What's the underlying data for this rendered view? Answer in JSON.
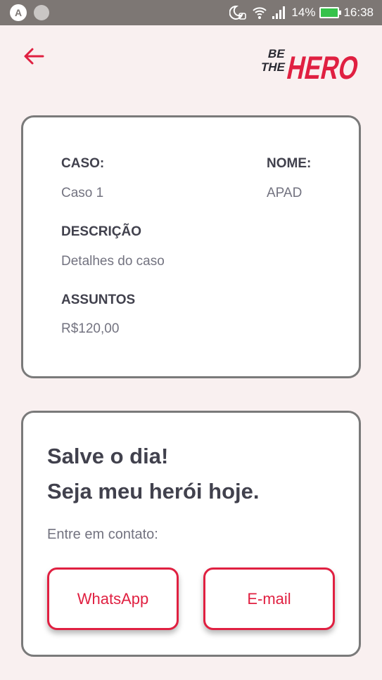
{
  "status_bar": {
    "battery": "14%",
    "time": "16:38",
    "app_badge": "A"
  },
  "header": {
    "back_icon": "arrow-left-icon",
    "logo_lines": [
      "BE",
      "THE",
      "HERO"
    ]
  },
  "incident": {
    "case_label": "CASO:",
    "case_value": "Caso 1",
    "name_label": "NOME:",
    "name_value": "APAD",
    "description_label": "DESCRIÇÃO",
    "description_value": "Detalhes do caso",
    "subjects_label": "ASSUNTOS",
    "subjects_value": "R$120,00"
  },
  "contact_box": {
    "title_line1": "Salve o dia!",
    "title_line2": "Seja meu herói hoje.",
    "description": "Entre em contato:",
    "whatsapp_label": "WhatsApp",
    "email_label": "E-mail"
  },
  "colors": {
    "accent": "#e02041",
    "background": "#f9f0f0",
    "text_dark": "#41414d",
    "text_light": "#737380"
  }
}
